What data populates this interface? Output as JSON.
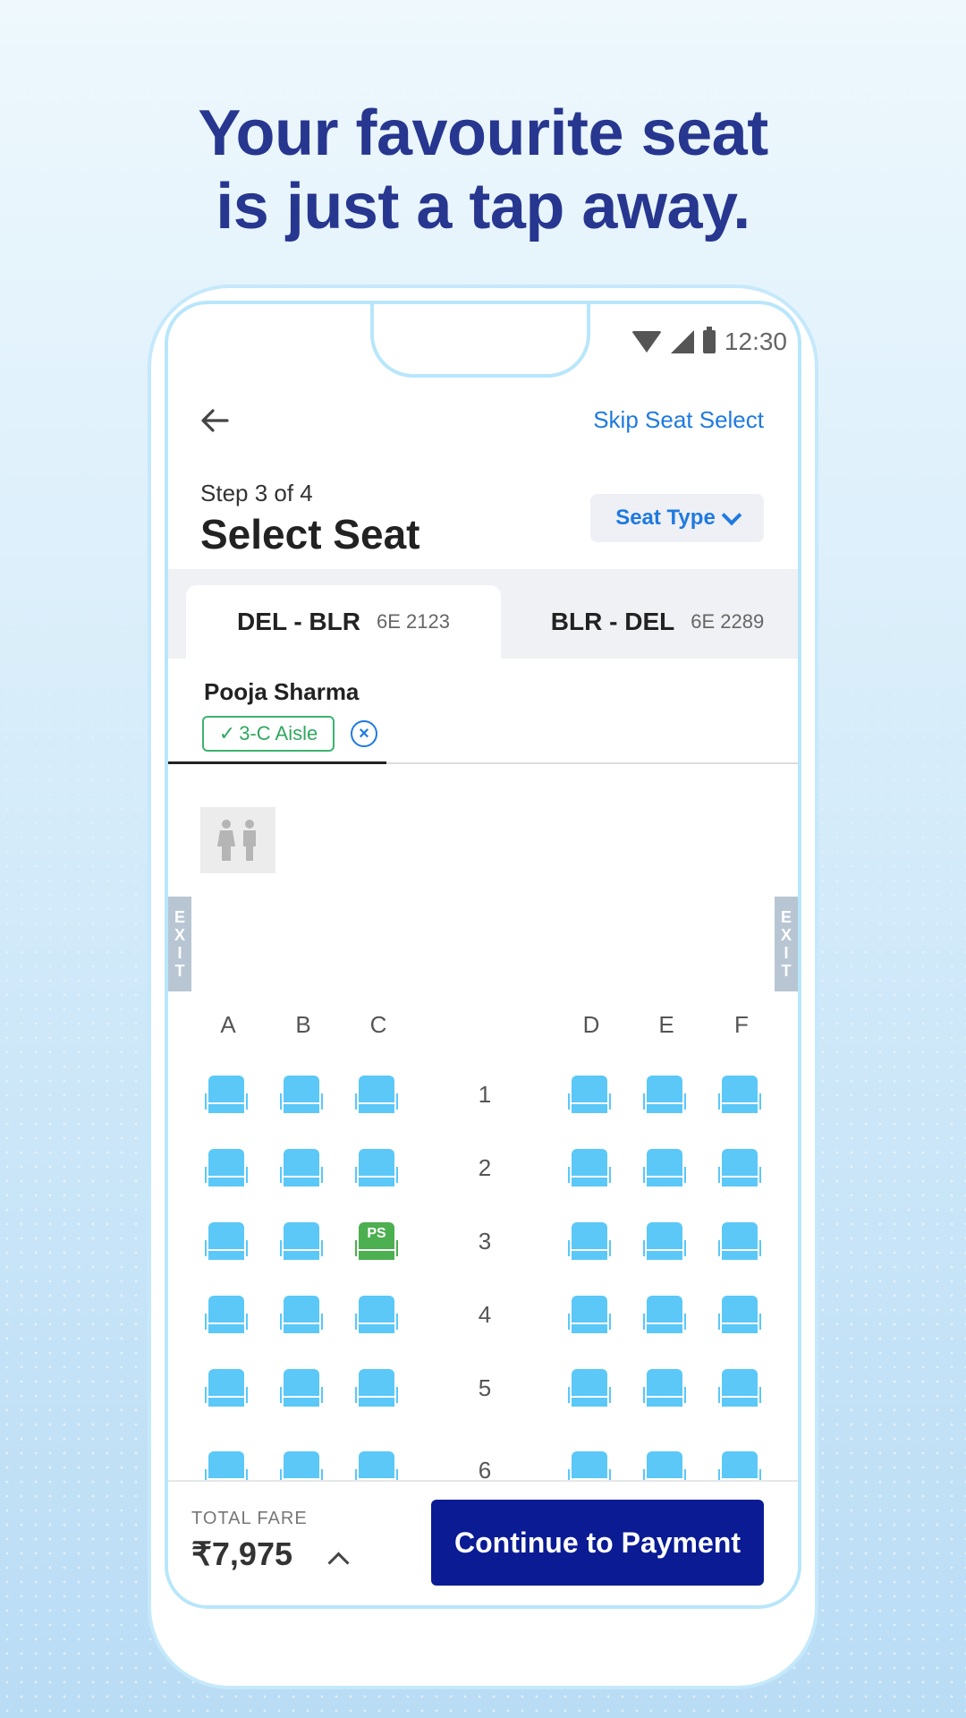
{
  "headline": {
    "line1": "Your favourite seat",
    "line2": "is just a tap away."
  },
  "status_bar": {
    "time": "12:30"
  },
  "header": {
    "skip_label": "Skip Seat Select",
    "step": "Step 3 of 4",
    "title": "Select Seat",
    "seat_type_label": "Seat Type"
  },
  "tabs": [
    {
      "route": "DEL - BLR",
      "flight": "6E 2123",
      "active": true
    },
    {
      "route": "BLR - DEL",
      "flight": "6E 2289",
      "active": false
    }
  ],
  "passenger": {
    "name": "Pooja Sharma",
    "seat": "3-C Aisle",
    "check": "✓"
  },
  "exit_label": [
    "E",
    "X",
    "I",
    "T"
  ],
  "seat_map": {
    "columns": [
      "A",
      "B",
      "C",
      "D",
      "E",
      "F"
    ],
    "rows": [
      "1",
      "2",
      "3",
      "4",
      "5",
      "6"
    ],
    "selected": {
      "row": "3",
      "col": "C",
      "badge": "PS"
    }
  },
  "footer": {
    "fare_label": "TOTAL FARE",
    "fare": "₹7,975",
    "cta": "Continue to Payment"
  },
  "colors": {
    "headline": "#27368f",
    "accent": "#1f7ae0",
    "seat": "#5bc8f7",
    "selected_seat": "#4caf50",
    "cta": "#0a1b94"
  },
  "icons": [
    "back-arrow-icon",
    "wifi-icon",
    "signal-icon",
    "battery-icon",
    "chevron-down-icon",
    "close-icon",
    "lavatory-icon",
    "chevron-up-icon",
    "seat-icon"
  ]
}
